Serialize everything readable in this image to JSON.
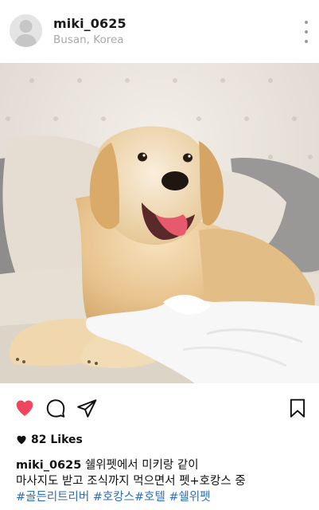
{
  "post": {
    "username": "miki_0625",
    "location": "Busan, Korea",
    "likes_text": "82 Likes",
    "caption_line1": "쉘위펫에서 미키랑 같이",
    "caption_line2": "마사지도 받고 조식까지 먹으면서 펫+호캉스 중",
    "hashtags": "#골든리트리버 #호캉스#호텔 #쉘위펫",
    "liked": true,
    "accent_color": "#f0455e",
    "hashtag_color": "#2f6fb8"
  },
  "icons": {
    "avatar": "user-avatar-icon",
    "more": "more-vertical-icon",
    "like": "heart-icon",
    "comment": "comment-icon",
    "share": "send-icon",
    "save": "bookmark-icon"
  }
}
